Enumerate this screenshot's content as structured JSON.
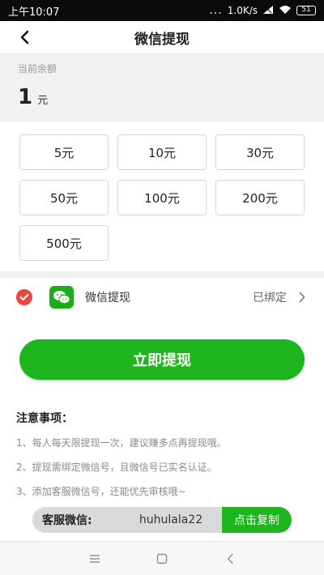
{
  "status_bar": {
    "time": "上午10:07",
    "dots": "...",
    "speed": "1.0K/s",
    "battery": "51"
  },
  "header": {
    "title": "微信提现"
  },
  "balance": {
    "label": "当前余额",
    "amount": "1",
    "unit": "元"
  },
  "amounts": [
    "5元",
    "10元",
    "30元",
    "50元",
    "100元",
    "200元",
    "500元"
  ],
  "method": {
    "label": "微信提现",
    "status": "已绑定"
  },
  "submit": {
    "label": "立即提现"
  },
  "notes": {
    "title": "注意事项：",
    "items": [
      "1、每人每天限提现一次，建议赚多点再提现哦。",
      "2、提现需绑定微信号，且微信号已实名认证。",
      "3、添加客服微信号，还能优先审核哦~"
    ]
  },
  "service": {
    "label": "客服微信:",
    "id": "huhulala22",
    "copy_label": "点击复制"
  },
  "colors": {
    "accent_green": "#1fb51f",
    "wechat_green": "#1aad19",
    "check_red": "#e8463f"
  }
}
